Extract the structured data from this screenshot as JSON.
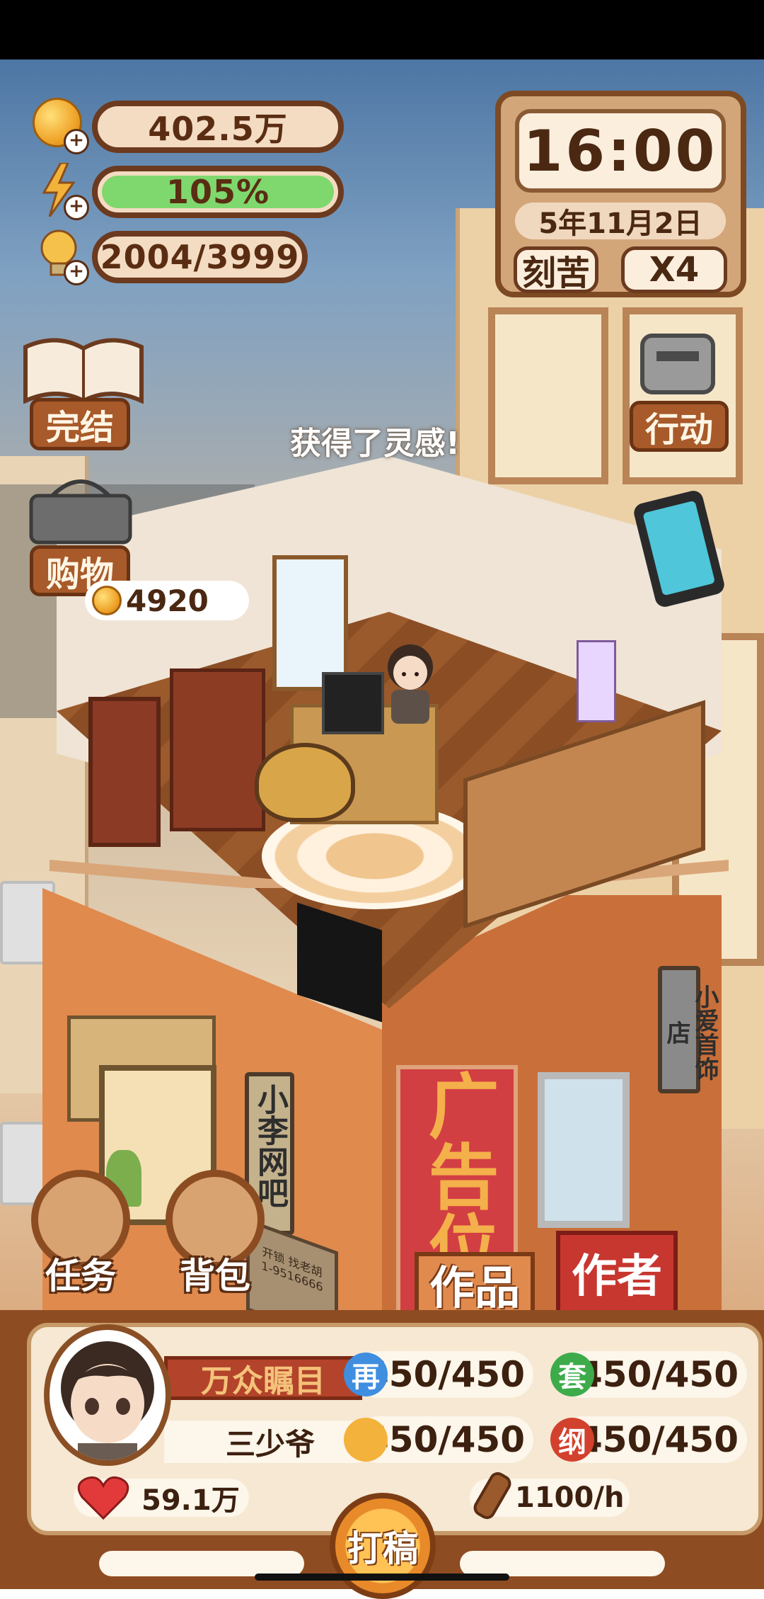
{
  "hud": {
    "coins": "402.5万",
    "energy": "105%",
    "energy_fill": 1.0,
    "inspiration": "2004/3999",
    "plus": "+"
  },
  "clock": {
    "time": "16:00",
    "date": "5年11月2日",
    "mode_label": "刻苦",
    "speed_label": "X4"
  },
  "side_buttons": {
    "finish": "完结",
    "shopping": "购物",
    "action": "行动"
  },
  "toast": "获得了灵感!",
  "room": {
    "coin_bubble": "4920"
  },
  "street_signs": {
    "internet_cafe": "小李网吧",
    "jewelry_shop": "小爱首饰店",
    "ad_board": "广告位",
    "small_sign_line1": "开锁 找老胡",
    "small_sign_line2": "1-9516666"
  },
  "round_buttons": {
    "tasks": "任务",
    "bag": "背包"
  },
  "tabs": {
    "works": "作品",
    "author": "作者"
  },
  "profile": {
    "title": "万众瞩目",
    "name": "三少爷",
    "likes": "59.1万",
    "rate": "1100/h"
  },
  "stats": [
    {
      "icon_char": "再",
      "value": "450/450",
      "color": "#3f8ee0"
    },
    {
      "icon_char": "套",
      "value": "450/450",
      "color": "#3dab4a"
    },
    {
      "icon_char": "",
      "value": "450/450",
      "color": "#f3b23b"
    },
    {
      "icon_char": "纲",
      "value": "450/450",
      "color": "#d2412d"
    }
  ],
  "write_button": "打稿",
  "colors": {
    "panel_brown": "#8e4c22",
    "energy_green": "#7fd86d",
    "author_tab_red": "#c7372f",
    "works_tab": "#e08a4e"
  },
  "icons": [
    "coin-icon",
    "lightning-icon",
    "lightbulb-icon",
    "book-icon",
    "basket-icon",
    "key-icon",
    "tablet-icon",
    "heart-icon",
    "pencil-icon"
  ]
}
